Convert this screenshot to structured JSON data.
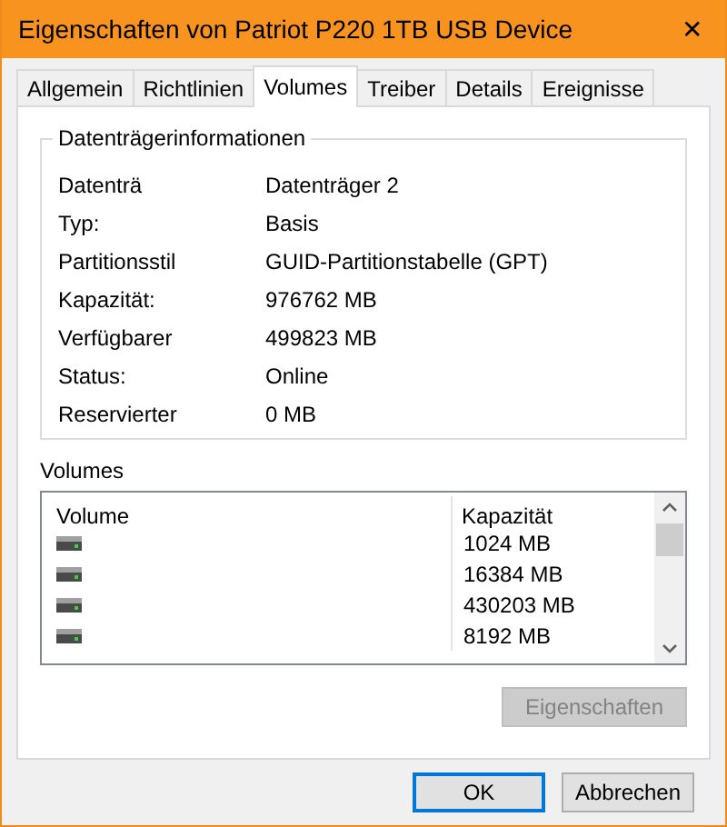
{
  "window": {
    "title": "Eigenschaften von Patriot P220 1TB USB Device",
    "close": "✕"
  },
  "tabs": [
    {
      "label": "Allgemein",
      "selected": false
    },
    {
      "label": "Richtlinien",
      "selected": false
    },
    {
      "label": "Volumes",
      "selected": true
    },
    {
      "label": "Treiber",
      "selected": false
    },
    {
      "label": "Details",
      "selected": false
    },
    {
      "label": "Ereignisse",
      "selected": false
    }
  ],
  "disk_info": {
    "title": "Datenträgerinformationen",
    "rows": [
      {
        "label": "Datenträ",
        "value": "Datenträger 2"
      },
      {
        "label": "Typ:",
        "value": "Basis"
      },
      {
        "label": "Partitionsstil",
        "value": "GUID-Partitionstabelle (GPT)"
      },
      {
        "label": "Kapazität:",
        "value": "976762 MB"
      },
      {
        "label": "Verfügbarer",
        "value": "499823 MB"
      },
      {
        "label": "Status:",
        "value": "Online"
      },
      {
        "label": "Reservierter",
        "value": "0 MB"
      }
    ]
  },
  "volumes": {
    "title": "Volumes",
    "columns": [
      "Volume",
      "Kapazität"
    ],
    "rows": [
      {
        "capacity": "1024 MB"
      },
      {
        "capacity": "16384 MB"
      },
      {
        "capacity": "430203 MB"
      },
      {
        "capacity": "8192 MB"
      }
    ],
    "properties_button": {
      "label": "Eigenschaften",
      "disabled": true
    }
  },
  "buttons": [
    {
      "label": "OK",
      "default": true
    },
    {
      "label": "Abbrechen",
      "default": false
    }
  ]
}
